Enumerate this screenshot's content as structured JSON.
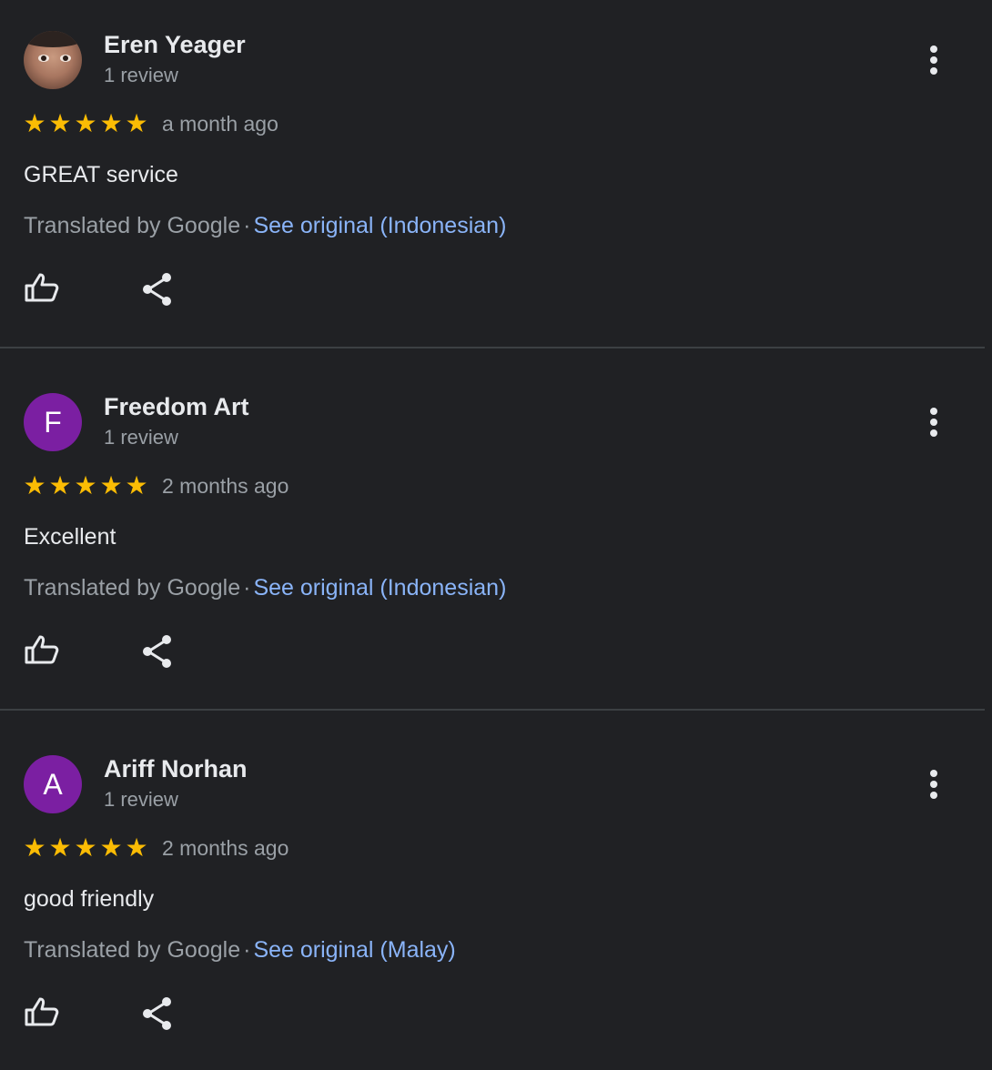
{
  "reviews": [
    {
      "name": "Eren Yeager",
      "review_count": "1 review",
      "avatar": {
        "type": "photo",
        "letter": "",
        "color": "#a87660"
      },
      "rating": 5,
      "stars": [
        "★",
        "★",
        "★",
        "★",
        "★"
      ],
      "date": "a month ago",
      "text": "GREAT service",
      "translated_label": "Translated by Google",
      "separator": "·",
      "see_original": "See original (Indonesian)",
      "icons": {
        "like": "thumb-up-icon",
        "share": "share-icon",
        "more": "more-vert-icon"
      }
    },
    {
      "name": "Freedom Art",
      "review_count": "1 review",
      "avatar": {
        "type": "letter",
        "letter": "F",
        "color": "#7b1fa2"
      },
      "rating": 5,
      "stars": [
        "★",
        "★",
        "★",
        "★",
        "★"
      ],
      "date": "2 months ago",
      "text": "Excellent",
      "translated_label": "Translated by Google",
      "separator": "·",
      "see_original": "See original (Indonesian)",
      "icons": {
        "like": "thumb-up-icon",
        "share": "share-icon",
        "more": "more-vert-icon"
      }
    },
    {
      "name": "Ariff Norhan",
      "review_count": "1 review",
      "avatar": {
        "type": "letter",
        "letter": "A",
        "color": "#7b1fa2"
      },
      "rating": 5,
      "stars": [
        "★",
        "★",
        "★",
        "★",
        "★"
      ],
      "date": "2 months ago",
      "text": "good friendly",
      "translated_label": "Translated by Google",
      "separator": "·",
      "see_original": "See original (Malay)",
      "icons": {
        "like": "thumb-up-icon",
        "share": "share-icon",
        "more": "more-vert-icon"
      }
    }
  ],
  "colors": {
    "background": "#202124",
    "star": "#fbbc04",
    "link": "#8ab4f8",
    "primary_text": "#e8eaed",
    "secondary_text": "#9aa0a6",
    "divider": "#3c4043"
  }
}
